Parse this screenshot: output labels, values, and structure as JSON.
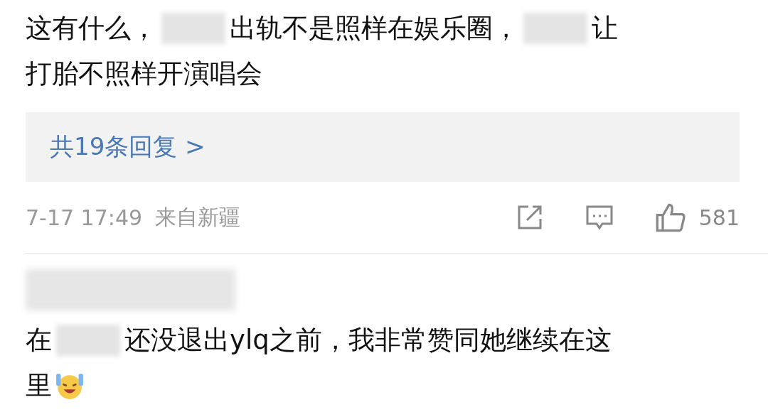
{
  "comments": [
    {
      "lines": [
        [
          {
            "kind": "text",
            "text": "这有什么，"
          },
          {
            "kind": "redacted"
          },
          {
            "kind": "text",
            "text": "出轨不是照样在娱乐圈，"
          },
          {
            "kind": "redacted"
          },
          {
            "kind": "text",
            "text": "让"
          }
        ],
        [
          {
            "kind": "text",
            "text": "打胎不照样开演唱会"
          }
        ]
      ],
      "replies": "共19条回复 >",
      "time": "7-17 17:49",
      "location": "来自新疆",
      "likes": "581"
    },
    {
      "author": {
        "kind": "redacted"
      },
      "lines": [
        [
          {
            "kind": "text",
            "text": "在"
          },
          {
            "kind": "redacted"
          },
          {
            "kind": "text",
            "text": "还没退出ylq之前，我非常赞同她继续在这"
          }
        ],
        [
          {
            "kind": "text",
            "text": "里"
          },
          {
            "kind": "emoji"
          }
        ]
      ]
    }
  ]
}
